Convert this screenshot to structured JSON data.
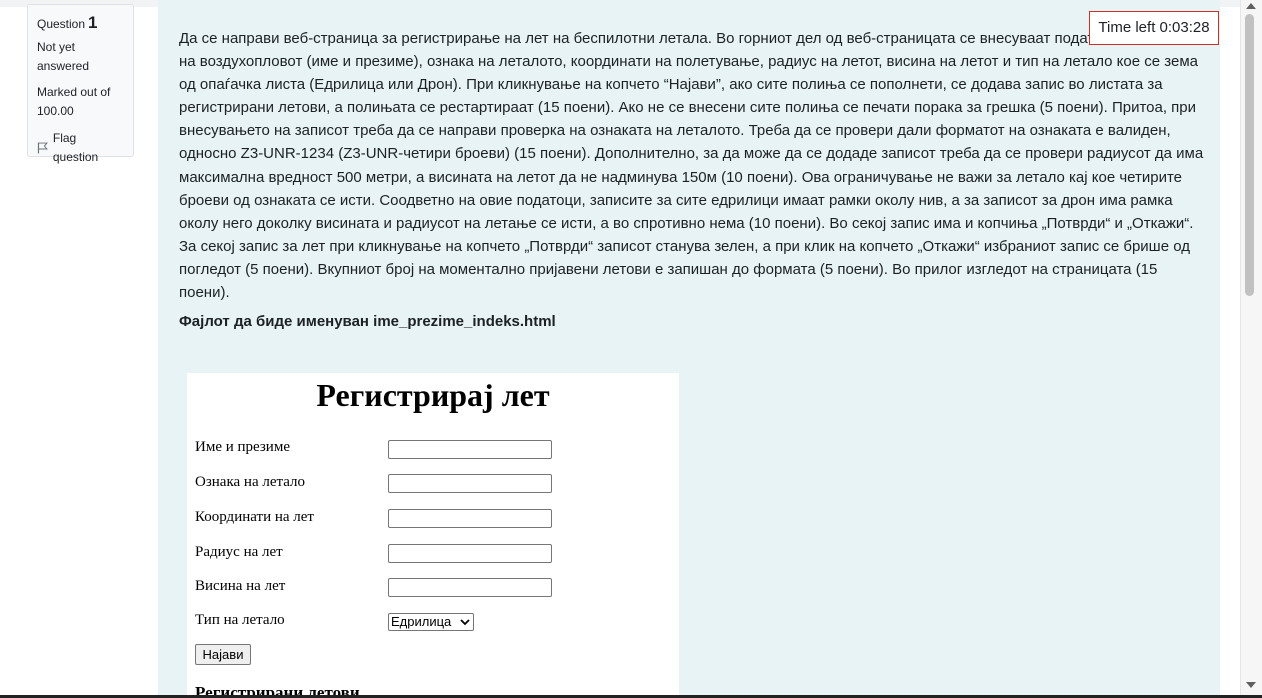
{
  "question": {
    "label": "Question",
    "number": "1",
    "state": "Not yet answered",
    "mark": "Marked out of 100.00",
    "flag_label": "Flag question"
  },
  "timer": {
    "text": "Time left 0:03:28"
  },
  "qtext": "Да се направи веб-страница за регистрирање на лет на беспилотни летала. Во горниот дел од веб-страницата се внесуваат подат сопственикот на воздухопловот (име и презиме), ознака на леталото, координати на полетување, радиус на летот, висина на летот и тип на летало кое се зема од опаѓачка листа (Едрилица или Дрон). При кликнување на копчето “Најави”, ако сите полиња се пополнети, се додава запис во листата за регистрирани летови, а полињата се рестартираат (15 поени). Ако не се внесени сите полиња се печати порака за грешка (5 поени). Притоа, при внесувањето на записот треба да се направи проверка на ознаката на леталото. Треба да се провери дали форматот на ознаката е валиден, односно Z3-UNR-1234 (Z3-UNR-четири броеви) (15 поени). Дополнително, за да може да се додаде записот треба да се провери радиусот да има максимална вредност 500 метри, а висината на летот да не надминува 150м (10 поени). Ова ограничување не важи за летало кај кое четирите броеви од ознаката се исти. Соодветно на овие податоци, записите за сите едрилици имаат рамки околу нив, а за записот за дрон има рамка околу него доколку висината и радиусот на летање се исти, а во спротивно нема (10 поени). Во секој запис има и копчиња „Потврди“ и „Откажи“. За секој запис за лет при кликнување на копчето „Потврди“ записот станува зелен, а при клик на копчето „Откажи“ избраниот запис се брише од погледот (5 поени). Вкупниот број на моментално пријавени летови е запишан до формата (5 поени). Во прилог изгледот на страницата (15 поени).",
  "filename": "Фајлот да биде именуван ime_prezime_indeks.html",
  "form": {
    "title": "Регистрирај лет",
    "fields": [
      {
        "label": "Име и презиме"
      },
      {
        "label": "Ознака на летало"
      },
      {
        "label": "Координати на лет"
      },
      {
        "label": "Радиус на лет"
      },
      {
        "label": "Висина на лет"
      }
    ],
    "type_label": "Тип на летало",
    "type_selected": "Едрилица",
    "submit_label": "Најави",
    "registered_heading": "Регистрирани летови"
  }
}
